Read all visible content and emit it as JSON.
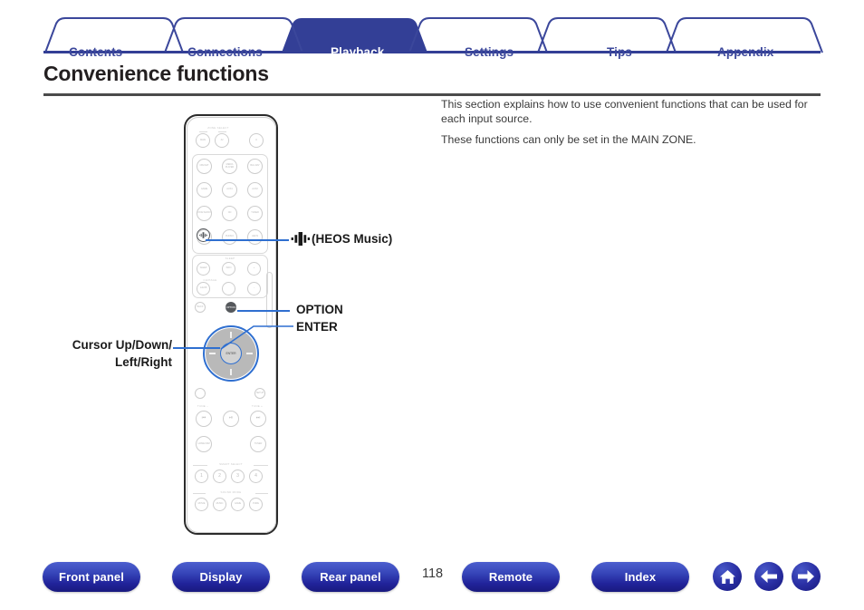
{
  "tabs": [
    {
      "label": "Contents",
      "active": false
    },
    {
      "label": "Connections",
      "active": false
    },
    {
      "label": "Playback",
      "active": true
    },
    {
      "label": "Settings",
      "active": false
    },
    {
      "label": "Tips",
      "active": false
    },
    {
      "label": "Appendix",
      "active": false
    }
  ],
  "page": {
    "title": "Convenience functions",
    "number": "118"
  },
  "intro": {
    "paragraph1": "This section explains how to use convenient functions that can be used for each input source.",
    "paragraph2": "These functions can only be set in the MAIN ZONE."
  },
  "callouts": {
    "heos": "(HEOS Music)",
    "option": "OPTION",
    "enter": "ENTER",
    "cursor_line1": "Cursor Up/Down/",
    "cursor_line2": "Left/Right"
  },
  "remote": {
    "zone_select_label": "ZONE SELECT",
    "zone_keys": [
      "MAIN",
      "Z2"
    ],
    "power_key": "⏻",
    "source_rows": [
      [
        "CBL/SAT",
        "MEDIA PLAYER",
        "BLU-RAY"
      ],
      [
        "GAME",
        "AUX1",
        "AUX2"
      ],
      [
        "DVD/ AUDIO",
        "CD",
        "TUNER"
      ],
      [
        "USB",
        "PHONO",
        "HEOS"
      ]
    ],
    "heos_key_icon": "heos-music-icon",
    "mid_keys": [
      "SLEEP",
      "INFO",
      "VOLUME"
    ],
    "nav_keys": [
      "BACK",
      "SETUP"
    ],
    "option_key": "OPTION",
    "enter_key": "ENTER",
    "transport_label_left": "TUNE −",
    "transport_label_right": "TUNE +",
    "transport_keys": [
      "⏮",
      "⏯",
      "⏭"
    ],
    "lower_keys": [
      "HOME/ DIM",
      "TUNER"
    ],
    "smart_select_label": "SMART SELECT",
    "smart_select_keys": [
      "1",
      "2",
      "3",
      "4"
    ],
    "sound_mode_label": "SOUND MODE",
    "sound_mode_keys": [
      "MOVIE",
      "MUSIC",
      "GAME",
      "PURE"
    ]
  },
  "bottom_nav": {
    "buttons": [
      {
        "label": "Front panel"
      },
      {
        "label": "Display"
      },
      {
        "label": "Rear panel"
      },
      {
        "label": "Remote"
      },
      {
        "label": "Index"
      }
    ],
    "icons": [
      {
        "name": "home-icon"
      },
      {
        "name": "back-arrow-icon"
      },
      {
        "name": "forward-arrow-icon"
      }
    ]
  },
  "colors": {
    "brand_blue": "#3b479b",
    "active_tab": "#333f96",
    "leader_line": "#2f6fd0",
    "pill_dark": "#21239a"
  }
}
